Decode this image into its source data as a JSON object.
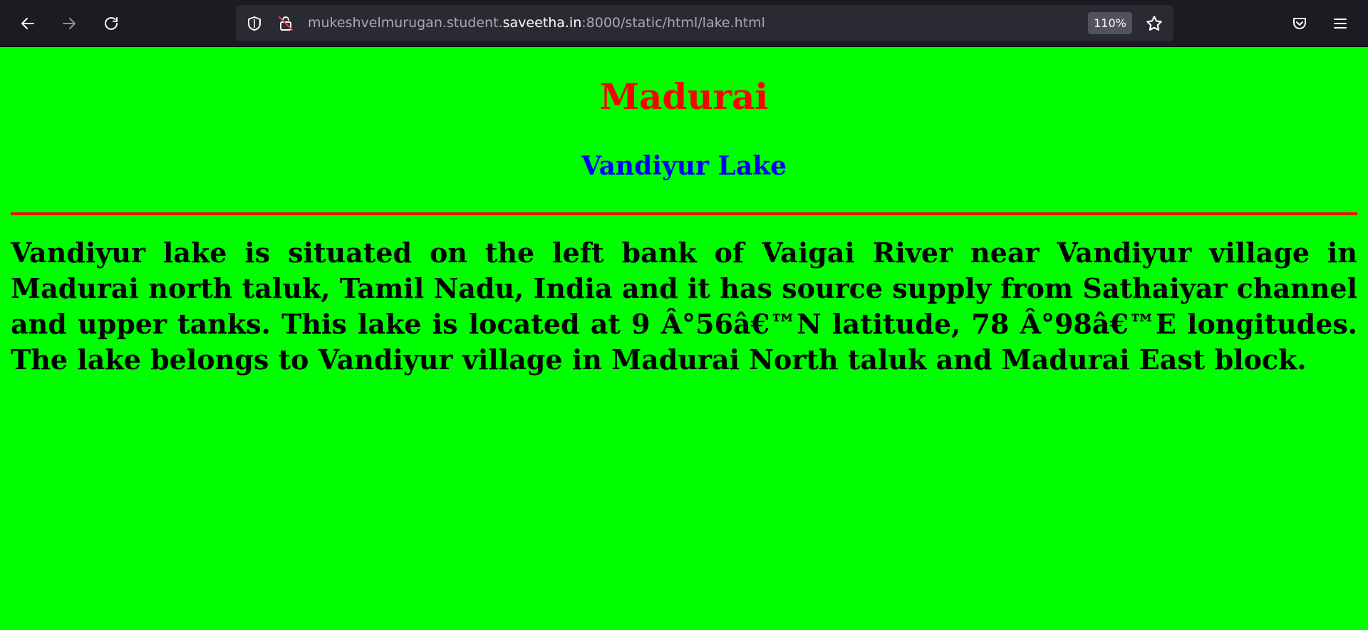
{
  "browser": {
    "url_prefix": "mukeshvelmurugan.student.",
    "url_domain": "saveetha.in",
    "url_suffix": ":8000/static/html/lake.html",
    "zoom": "110%",
    "icons": [
      "back-icon",
      "forward-icon",
      "reload-icon",
      "shield-icon",
      "insecure-lock-icon",
      "star-icon",
      "pocket-icon",
      "menu-icon"
    ]
  },
  "page": {
    "heading": "Madurai",
    "subheading": "Vandiyur Lake",
    "paragraph": "Vandiyur lake is situated on the left bank of Vaigai River near Vandiyur village in Madurai north taluk, Tamil Nadu, India and it has source supply from Sathaiyar channel and upper tanks. This lake is located at 9 Â°56â€™N latitude, 78 Â°98â€™E longitudes. The lake belongs to Vandiyur village in Madurai North taluk and Madurai East block.",
    "colors": {
      "background": "#00ff00",
      "heading": "#ff0000",
      "subheading": "#0000ff",
      "rule": "#ff0000",
      "text": "#000000"
    }
  }
}
